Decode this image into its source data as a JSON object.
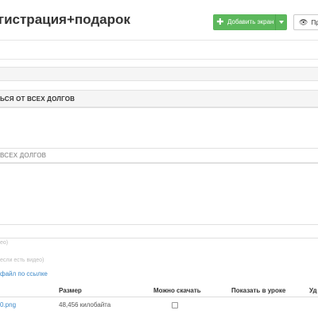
{
  "header": {
    "title": "гистрация+подарок",
    "add_screen_label": "Добавить экран",
    "preview_label": "Про"
  },
  "section": {
    "title": "ься от всех долгов",
    "field_value": "всех долгов"
  },
  "hints": {
    "hint1": "ео)",
    "hint2": "если есть видео)"
  },
  "upload": {
    "link_label": "файл по ссылке"
  },
  "table": {
    "headers": {
      "size": "Размер",
      "can_download": "Можно скачать",
      "show_in_lesson": "Показать в уроке",
      "delete": "Уд"
    },
    "rows": [
      {
        "file": "0.png",
        "size": "48,456 килобайта",
        "can_download": false
      }
    ]
  },
  "colors": {
    "accent_green": "#5cb85c",
    "link_blue": "#3a87c8"
  }
}
